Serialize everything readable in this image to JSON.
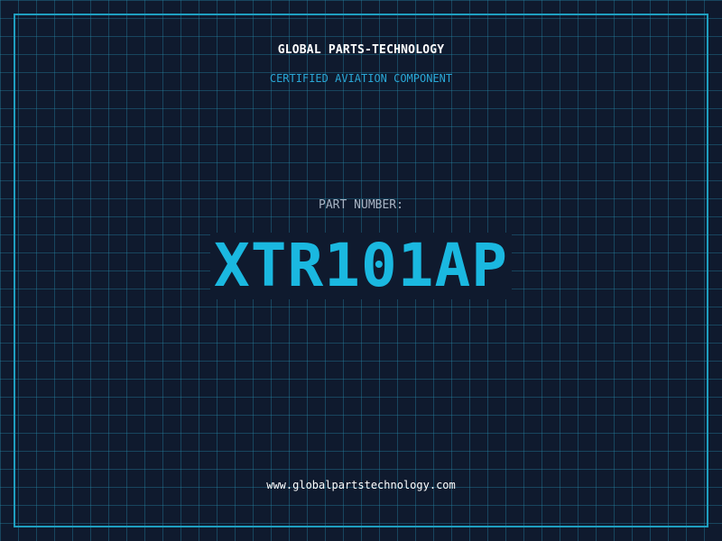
{
  "label": {
    "company_name": "GLOBAL PARTS-TECHNOLOGY",
    "certification": "CERTIFIED AVIATION COMPONENT",
    "part_number_label": "PART NUMBER:",
    "part_number": "XTR101AP",
    "website": "www.globalpartstechnology.com"
  },
  "colors": {
    "background": "#0f1a2e",
    "grid_line": "#1f6f88",
    "frame_border": "#1f9fc0",
    "accent_cyan": "#1ab8e0",
    "heading_white": "#ffffff",
    "label_gray": "#a8b4c4"
  }
}
